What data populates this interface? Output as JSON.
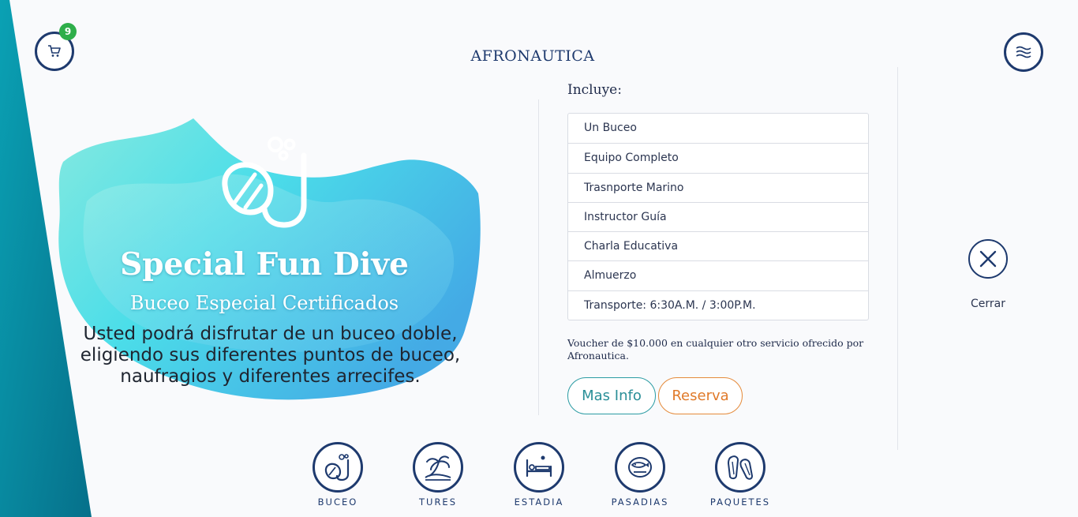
{
  "header": {
    "logo_text": "AFRONAUTICA",
    "cart_count": "9",
    "cart_icon": "cart-icon",
    "menu_icon": "waves-menu-icon"
  },
  "hero": {
    "icon": "snorkel-mask-icon",
    "title": "Special Fun Dive",
    "subtitle": "Buceo Especial Certificados",
    "description": "Usted podrá disfrutar de un buceo doble, eligiendo sus diferentes puntos de buceo, naufragios y diferentes arrecifes."
  },
  "details": {
    "includes_title": "Incluye:",
    "items": [
      "Un Buceo",
      "Equipo Completo",
      "Trasnporte Marino",
      "Instructor Guía",
      "Charla Educativa",
      "Almuerzo",
      "Transporte: 6:30A.M. / 3:00P.M."
    ],
    "voucher": "Voucher de $10.000 en cualquier otro servicio ofrecido por Afronautica.",
    "more_info_label": "Mas Info",
    "book_label": "Reserva"
  },
  "close": {
    "label": "Cerrar"
  },
  "categories": [
    {
      "label": "BUCEO",
      "icon": "snorkel-icon"
    },
    {
      "label": "TURES",
      "icon": "palm-tree-icon"
    },
    {
      "label": "ESTADIA",
      "icon": "bed-icon"
    },
    {
      "label": "PASADIAS",
      "icon": "fish-icon"
    },
    {
      "label": "PAQUETES",
      "icon": "fins-icon"
    }
  ],
  "colors": {
    "brand_navy": "#1e3a6e",
    "teal_stripe": "#0b8aa0",
    "more_info_teal": "#2a9ba3",
    "book_orange": "#e58a3a",
    "badge_green": "#2eae4a"
  }
}
